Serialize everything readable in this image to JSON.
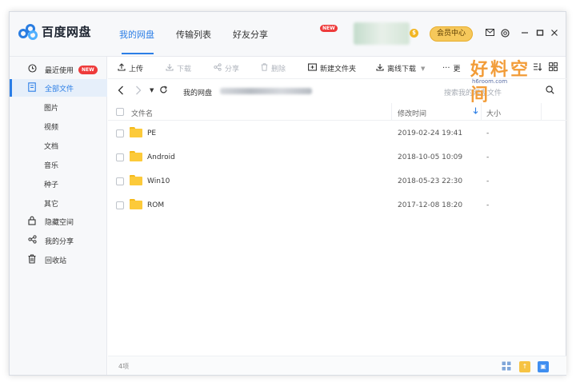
{
  "app": {
    "title": "百度网盘"
  },
  "header": {
    "tabs": [
      {
        "label": "我的网盘",
        "active": true
      },
      {
        "label": "传输列表",
        "active": false
      },
      {
        "label": "好友分享",
        "active": false
      }
    ],
    "new_badge": "NEW",
    "vip_symbol": "$",
    "vip_button": "会员中心"
  },
  "sidebar": {
    "items": [
      {
        "label": "最近使用",
        "icon": "clock-icon",
        "badge": "NEW"
      },
      {
        "label": "全部文件",
        "icon": "document-icon",
        "active": true
      },
      {
        "label": "图片"
      },
      {
        "label": "视频"
      },
      {
        "label": "文档"
      },
      {
        "label": "音乐"
      },
      {
        "label": "种子"
      },
      {
        "label": "其它"
      },
      {
        "label": "隐藏空间",
        "icon": "lock-icon"
      },
      {
        "label": "我的分享",
        "icon": "share-icon"
      },
      {
        "label": "回收站",
        "icon": "trash-icon"
      }
    ]
  },
  "toolbar": {
    "upload": "上传",
    "download": "下载",
    "share": "分享",
    "delete": "删除",
    "new_folder": "新建文件夹",
    "offline_download": "离线下载",
    "more": "更"
  },
  "path": {
    "root": "我的网盘",
    "search_placeholder": "搜索我的网盘文件"
  },
  "table": {
    "headers": {
      "name": "文件名",
      "modified": "修改时间",
      "size": "大小"
    },
    "rows": [
      {
        "name": "PE",
        "modified": "2019-02-24 19:41",
        "size": "-"
      },
      {
        "name": "Android",
        "modified": "2018-10-05 10:09",
        "size": "-"
      },
      {
        "name": "Win10",
        "modified": "2018-05-23 22:30",
        "size": "-"
      },
      {
        "name": "ROM",
        "modified": "2017-12-08 18:20",
        "size": "-"
      }
    ]
  },
  "footer": {
    "count": "4项"
  },
  "watermark": {
    "title": "好料空间",
    "url": "h6room.com"
  },
  "colors": {
    "accent": "#2b7ee6",
    "folder": "#fcca3a",
    "vip": "#f6c85b",
    "badge": "#ee3b3b"
  }
}
